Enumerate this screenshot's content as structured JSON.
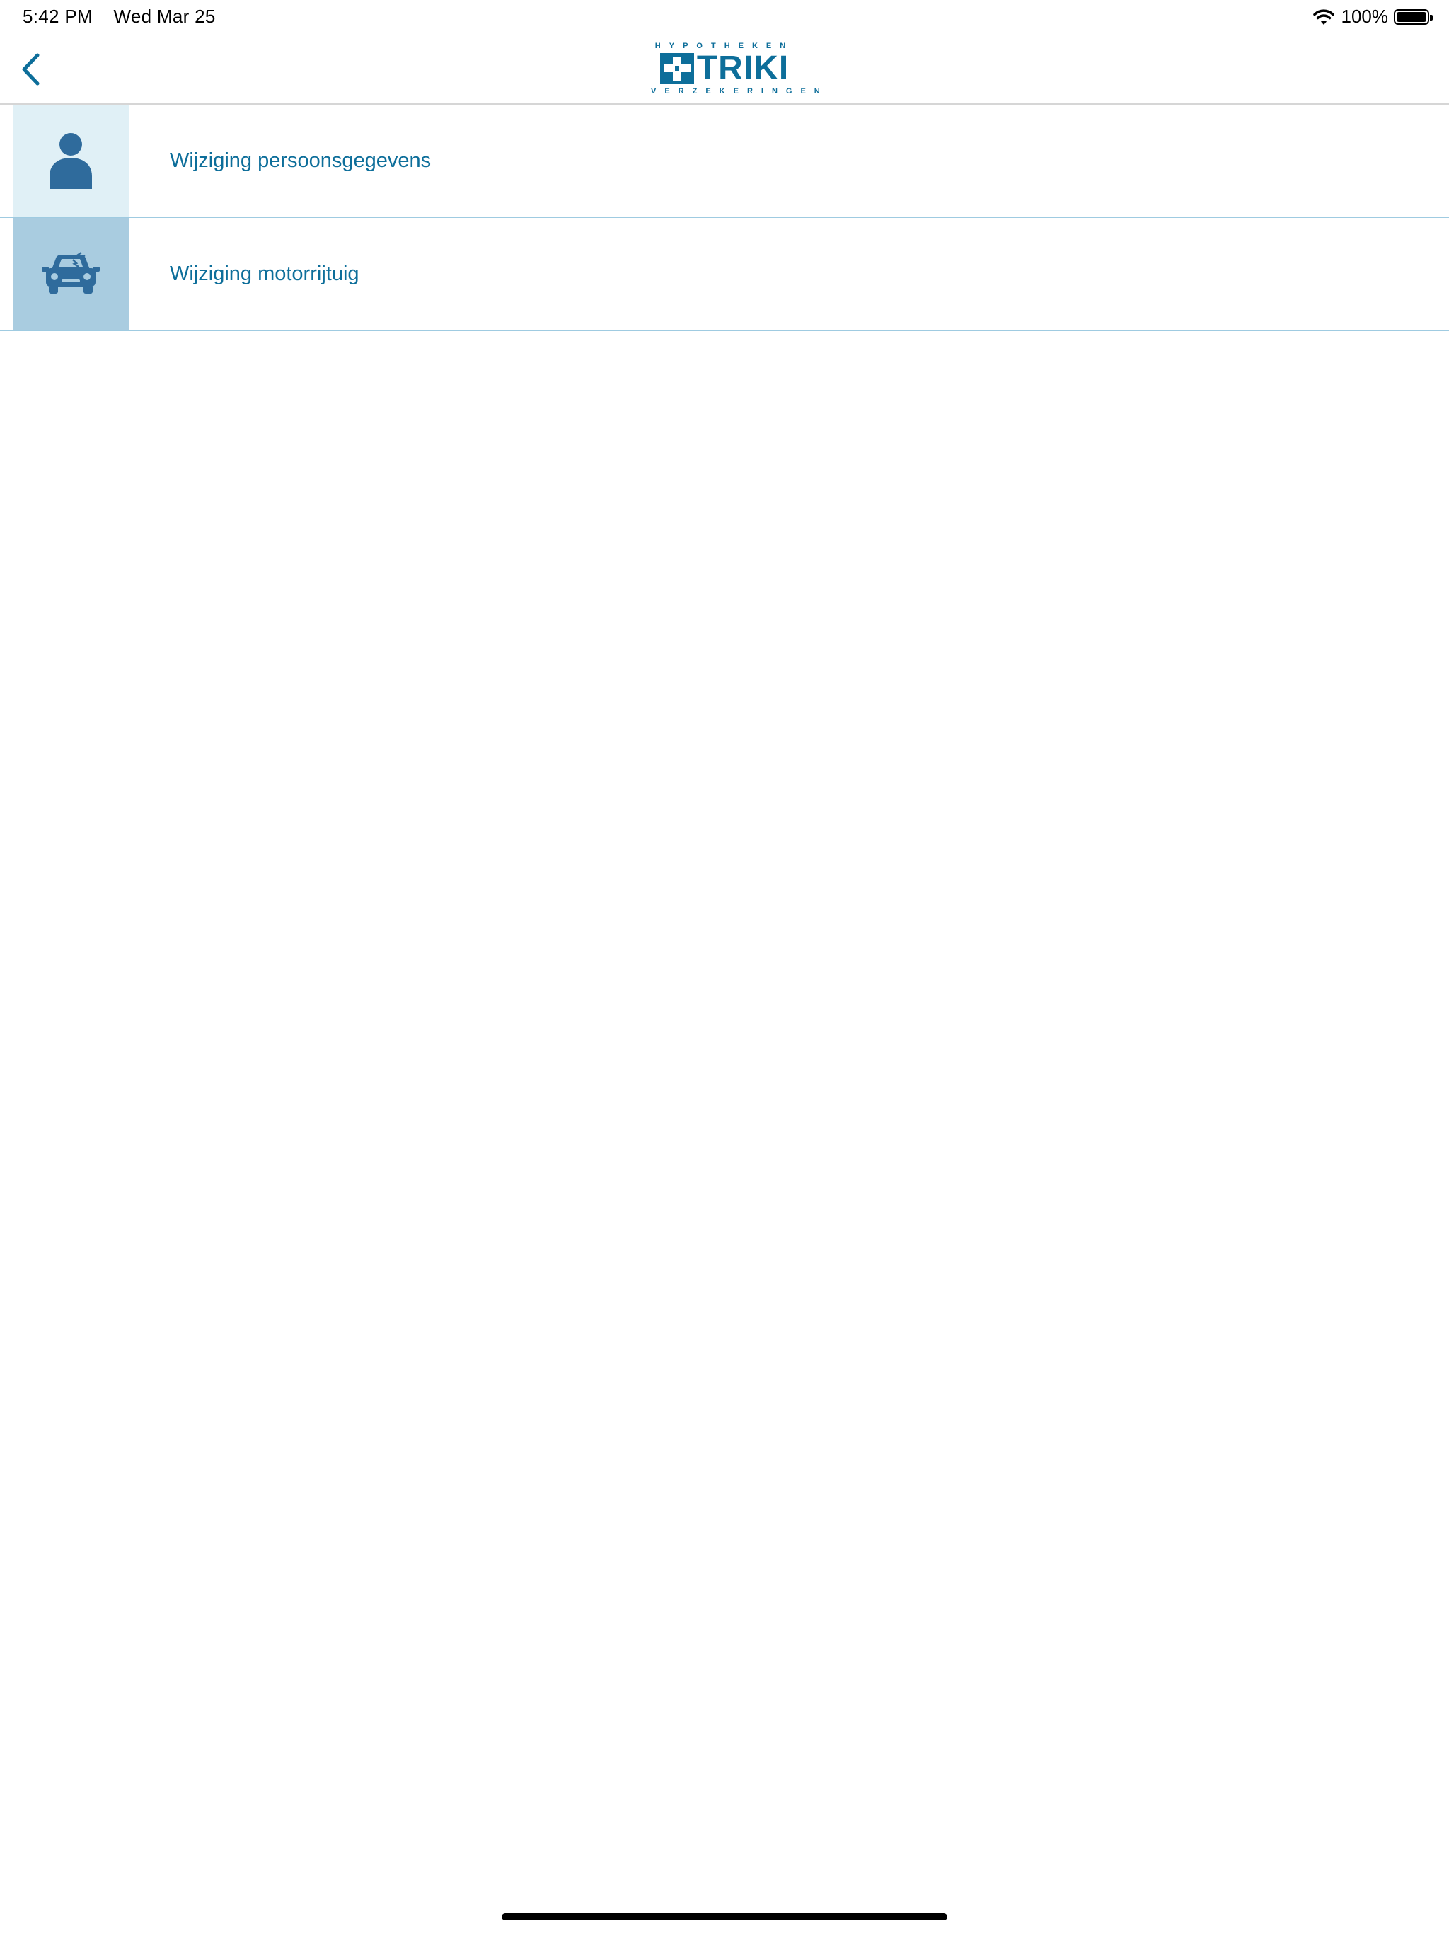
{
  "status_bar": {
    "time": "5:42 PM",
    "date": "Wed Mar 25",
    "battery_percent": "100%",
    "battery_level": 1.0,
    "icons": [
      "wifi-icon",
      "battery-icon"
    ]
  },
  "nav": {
    "back_icon": "chevron-left-icon",
    "logo": {
      "top": "HYPOTHEKEN",
      "word": "TRIKI",
      "bottom": "VERZEKERINGEN"
    }
  },
  "menu": {
    "items": [
      {
        "label": "Wijziging persoonsgegevens",
        "icon": "person-icon"
      },
      {
        "label": "Wijziging motorrijtuig",
        "icon": "car-damage-icon"
      }
    ]
  },
  "colors": {
    "accent": "#0d6e9a",
    "icon": "#2f6b9c",
    "tile_light": "#e0f0f6",
    "tile_mid": "#a9cce0",
    "divider": "#9fcbe1"
  }
}
